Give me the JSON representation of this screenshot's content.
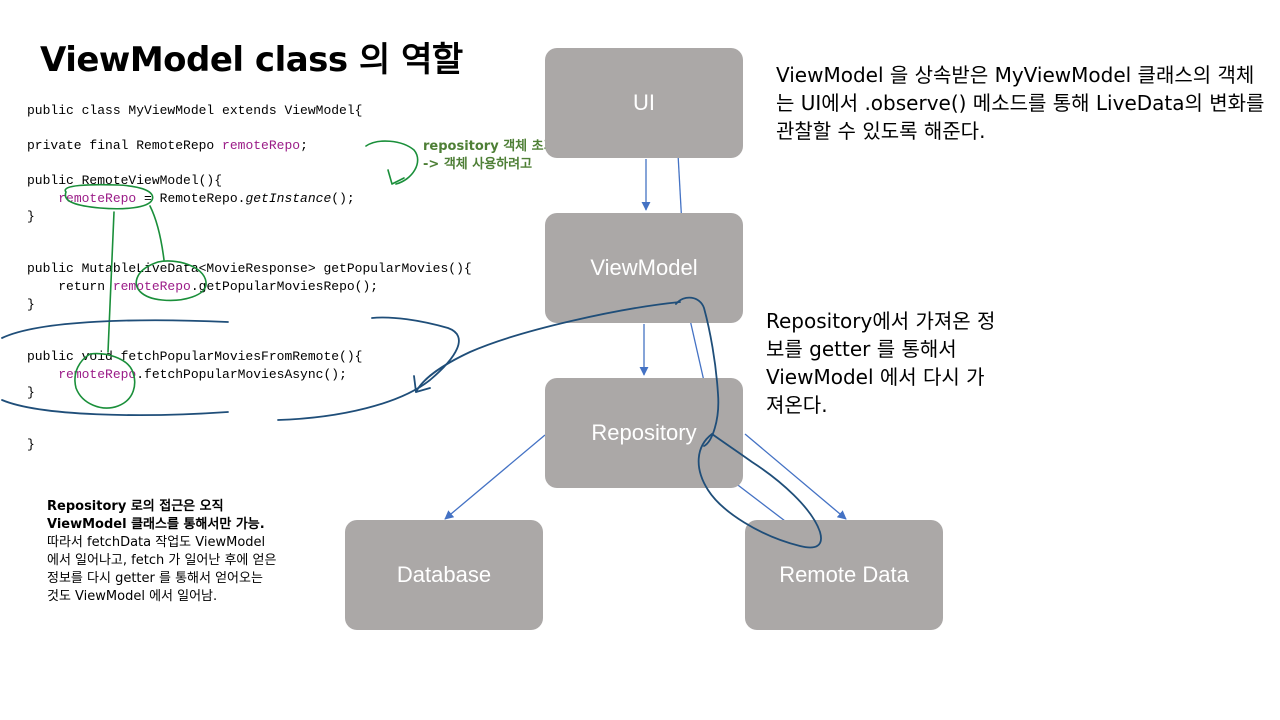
{
  "title": "ViewModel class 의 역할",
  "code": {
    "l1": "public class MyViewModel extends ViewModel{",
    "l2_kw": "private final RemoteRepo ",
    "l2_field": "remoteRepo",
    "l2_end": ";",
    "l3": "public RemoteViewModel(){",
    "l4_field": "remoteRepo",
    "l4_mid": " = RemoteRepo.",
    "l4_call": "getInstance",
    "l4_end": "();",
    "l5": "}",
    "l6": "public MutableLiveData<MovieResponse> getPopularMovies(){",
    "l7_kw": "return ",
    "l7_field": "remoteRepo",
    "l7_end": ".getPopularMoviesRepo();",
    "l8": "}",
    "l9": "public void fetchPopularMoviesFromRemote(){",
    "l10_field": "remoteRepo",
    "l10_end": ".fetchPopularMoviesAsync();",
    "l11": "}",
    "l12": "}"
  },
  "annotation": {
    "line1": "repository 객체 초기화",
    "line2": "-> 객체 사용하려고"
  },
  "boxes": {
    "ui": "UI",
    "viewmodel": "ViewModel",
    "repository": "Repository",
    "database": "Database",
    "remote": "Remote Data"
  },
  "desc_top": "ViewModel 을 상속받은 MyViewModel 클래스의 객체는 UI에서 .observe() 메소드를 통해 LiveData의 변화를 관찰할 수 있도록 해준다.",
  "desc_right": "Repository에서 가져온 정보를 getter 를 통해서 ViewModel 에서 다시 가져온다.",
  "desc_bottom": {
    "bold": "Repository 로의 접근은 오직 ViewModel 클래스를 통해서만 가능.",
    "normal": "따라서 fetchData 작업도 ViewModel 에서 일어나고, fetch 가 일어난 후에 얻은 정보를 다시 getter 를 통해서 얻어오는 것도 ViewModel 에서 일어남."
  },
  "colors": {
    "box": "#aba8a7",
    "arrow": "#4472c4",
    "ink_green": "#1a8f3a",
    "ink_blue": "#1f4e79",
    "annotation": "#4e7f36",
    "field": "#9b1d88"
  }
}
